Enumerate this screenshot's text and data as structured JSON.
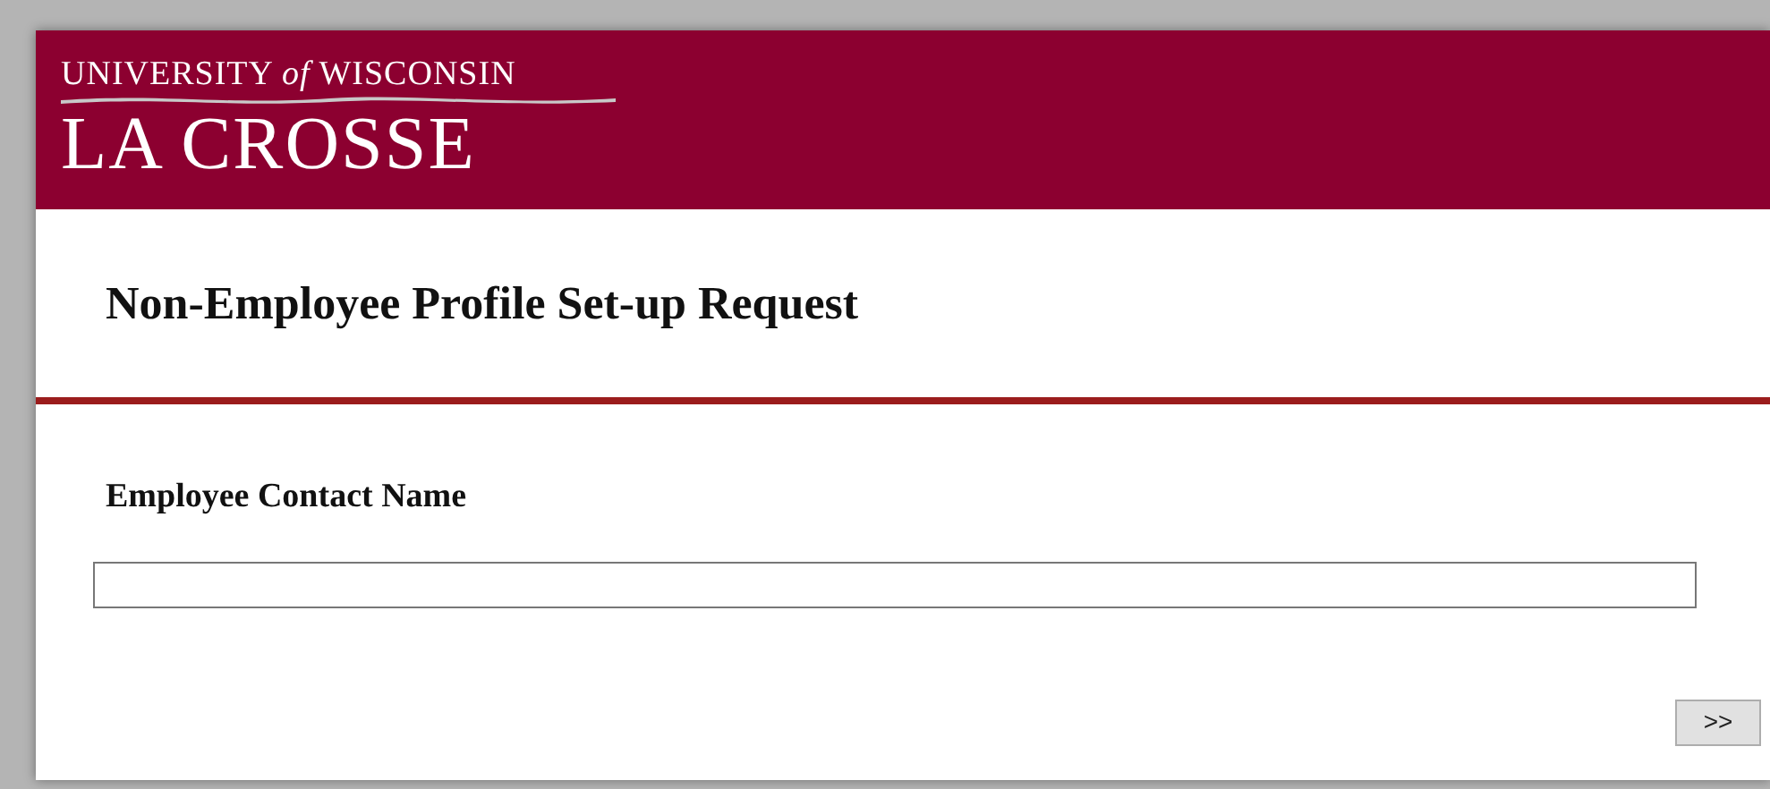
{
  "header": {
    "logo_line1": "UNIVERSITY *of* WISCONSIN",
    "logo_line2": "LA CROSSE"
  },
  "title": "Non-Employee Profile Set-up Request",
  "field": {
    "label": "Employee Contact Name"
  },
  "next_button": ">>"
}
